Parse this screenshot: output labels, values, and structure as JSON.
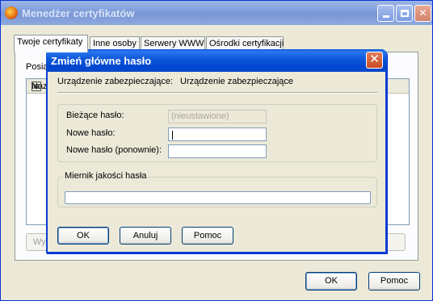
{
  "window": {
    "title": "Menedżer certyfikatów",
    "tabs": [
      "Twoje certyfikaty",
      "Inne osoby",
      "Serwery WWW",
      "Ośrodki certyfikacji"
    ],
    "active_tab": "Twoje certyfikaty",
    "panel_text": "Posia",
    "list_header": "Nazw",
    "bottom_button_stub": "Wy",
    "ok_label": "OK",
    "help_label": "Pomoc",
    "column_picker_icon": "column-picker-icon"
  },
  "dialog": {
    "title": "Zmień główne hasło",
    "device_label": "Urządzenie zabezpieczające:",
    "device_value": "Urządzenie zabezpieczające",
    "fields": {
      "current_label": "Bieżące hasło:",
      "current_value": "(nieustawione)",
      "new_label": "Nowe hasło:",
      "new_value": "",
      "confirm_label": "Nowe hasło (ponownie):",
      "confirm_value": ""
    },
    "meter_label": "Miernik jakości hasła",
    "meter_level": 0,
    "buttons": {
      "ok": "OK",
      "cancel": "Anuluj",
      "help": "Pomoc"
    },
    "accent_color": "#0a52d6",
    "close_color": "#d0532d"
  }
}
